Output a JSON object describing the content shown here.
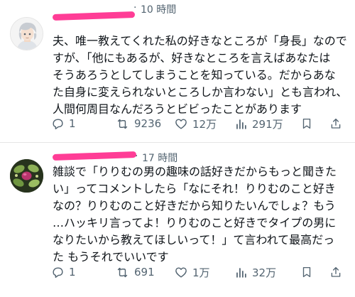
{
  "posts": [
    {
      "timestamp": "10 時間",
      "text": "夫、唯一教えてくれた私の好きなところが「身長」なので\nすが、「他にもあるが、好きなところを言えばあなたは\nそうあろうとしてしまうことを知っている。だからあな\nた自身に変えられないところしか言わない」とも言われ、\n人間何周目なんだろうとビビったことがあります",
      "replies": "1",
      "reposts": "9236",
      "likes": "12万",
      "views": "291万"
    },
    {
      "timestamp": "17 時間",
      "text": "雑談で「りりむの男の趣味の話好きだからもっと聞きた\nい」ってコメントしたら「なにそれ！りりむのこと好き\nなの？りりむのこと好きだから知りたいんでしょ？もう\n…ハッキリ言ってよ！りりむのこと好きでタイプの男に\nなりたいから教えてほしいって！」て言われて最高だっ\nた もうそれでいいです",
      "replies": "1",
      "reposts": "691",
      "likes": "1万",
      "views": "32万"
    }
  ],
  "icons": {
    "reply": "reply-icon",
    "repost": "repost-icon",
    "like": "heart-icon",
    "views": "views-bar-chart-icon",
    "bookmark": "bookmark-icon",
    "share": "share-icon"
  },
  "colors": {
    "text": "#0f1419",
    "secondary": "#536471",
    "redaction": "#ff3d96",
    "divider": "#e6e6e6"
  }
}
